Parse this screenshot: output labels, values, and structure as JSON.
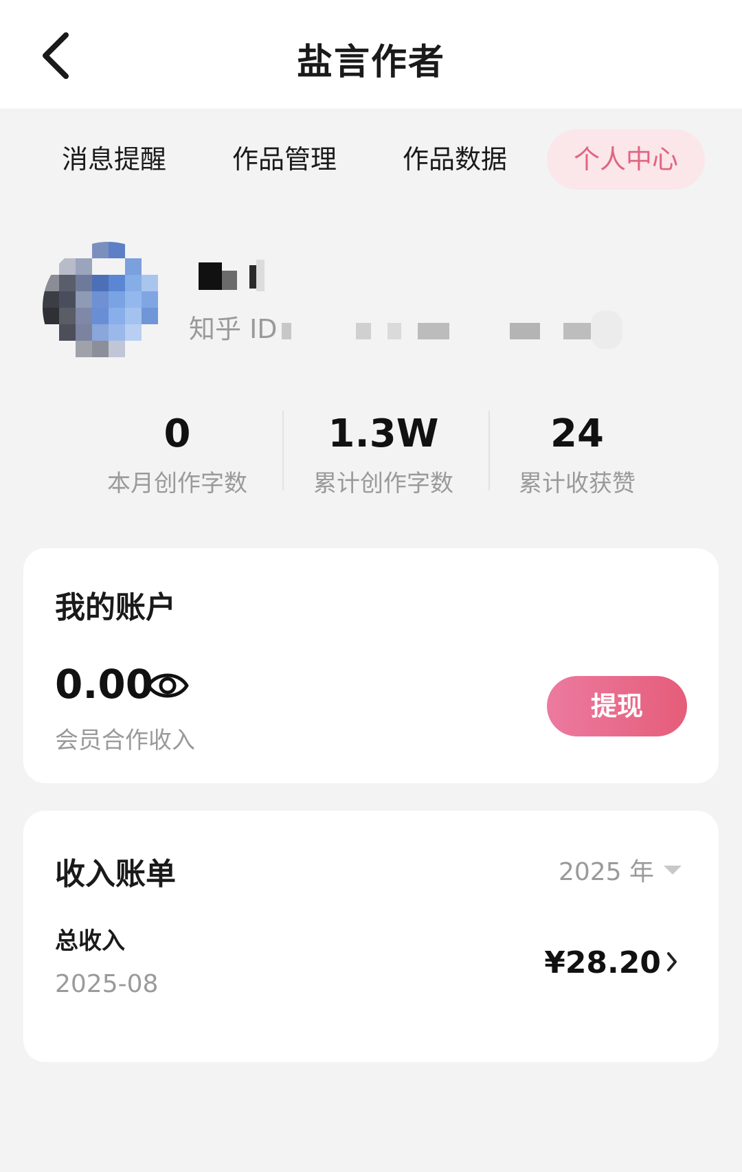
{
  "header": {
    "title": "盐言作者",
    "back_icon": "chevron-left-icon"
  },
  "tabs": [
    {
      "label": "消息提醒",
      "active": false
    },
    {
      "label": "作品管理",
      "active": false
    },
    {
      "label": "作品数据",
      "active": false
    },
    {
      "label": "个人中心",
      "active": true
    }
  ],
  "profile": {
    "id_label": "知乎 ID"
  },
  "stats": [
    {
      "value": "0",
      "label": "本月创作字数"
    },
    {
      "value": "1.3W",
      "label": "累计创作字数"
    },
    {
      "value": "24",
      "label": "累计收获赞"
    }
  ],
  "account": {
    "title": "我的账户",
    "balance": "0.00",
    "eye_icon": "eye-icon",
    "balance_label": "会员合作收入",
    "withdraw_label": "提现",
    "withdraw_color": "#e55d79"
  },
  "bills": {
    "title": "收入账单",
    "year": "2025 年",
    "year_icon": "caret-down-icon",
    "row": {
      "label": "总收入",
      "date": "2025-08",
      "amount": "¥28.20"
    }
  },
  "colors": {
    "accent": "#e06680",
    "accent_bg": "#fbe6ea",
    "page_bg": "#f3f3f4"
  }
}
